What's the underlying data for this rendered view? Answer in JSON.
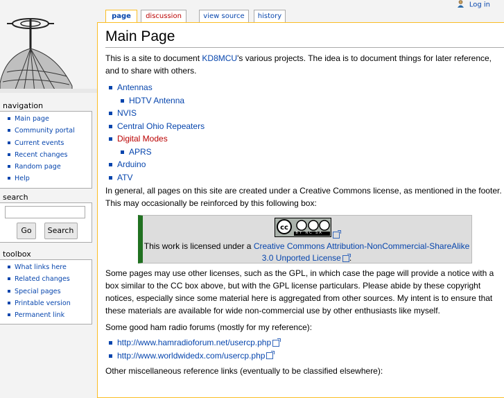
{
  "personal": {
    "login": "Log in"
  },
  "tabs": [
    {
      "label": "page"
    },
    {
      "label": "discussion"
    },
    {
      "label": "view source"
    },
    {
      "label": "history"
    }
  ],
  "content": {
    "title": "Main Page",
    "intro_pre": "This is a site to document ",
    "intro_link": "KD8MCU",
    "intro_post": "'s various projects. The idea is to document things for later reference, and to share with others.",
    "projects": [
      {
        "label": "Antennas",
        "level": 1,
        "new": false
      },
      {
        "label": "HDTV Antenna",
        "level": 2,
        "new": false
      },
      {
        "label": "NVIS",
        "level": 1,
        "new": false
      },
      {
        "label": "Central Ohio Repeaters",
        "level": 1,
        "new": false
      },
      {
        "label": "Digital Modes",
        "level": 1,
        "new": true
      },
      {
        "label": "APRS",
        "level": 2,
        "new": false
      },
      {
        "label": "Arduino",
        "level": 1,
        "new": false
      },
      {
        "label": "ATV",
        "level": 1,
        "new": false
      }
    ],
    "license_intro": "In general, all pages on this site are created under a Creative Commons license, as mentioned in the footer. This may occasionally be reinforced by this following box:",
    "cc_badge_text": "BY NC SA",
    "cc_text_pre": "This work is licensed under a ",
    "cc_link": "Creative Commons Attribution-NonCommercial-ShareAlike 3.0 Unported License",
    "cc_text_post": ".",
    "gpl_paragraph": "Some pages may use other licenses, such as the GPL, in which case the page will provide a notice with a box similar to the CC box above, but with the GPL license particulars. Please abide by these copyright notices, especially since some material here is aggregated from other sources. My intent is to ensure that these materials are available for wide non-commercial use by other enthusiasts like myself.",
    "forums_intro": "Some good ham radio forums (mostly for my reference):",
    "forums": [
      "http://www.hamradioforum.net/usercp.php",
      "http://www.worldwidedx.com/usercp.php"
    ],
    "misc_intro": "Other miscellaneous reference links (eventually to be classified elsewhere):"
  },
  "sidebar": {
    "navigation": {
      "title": "navigation",
      "items": [
        "Main page",
        "Community portal",
        "Current events",
        "Recent changes",
        "Random page",
        "Help"
      ]
    },
    "search": {
      "title": "search",
      "go": "Go",
      "search": "Search"
    },
    "toolbox": {
      "title": "toolbox",
      "items": [
        "What links here",
        "Related changes",
        "Special pages",
        "Printable version",
        "Permanent link"
      ]
    }
  },
  "colors": {
    "link": "#0645ad",
    "new_link": "#ba0000",
    "tab_border": "#fabd23",
    "cc_stripe": "#217121"
  }
}
